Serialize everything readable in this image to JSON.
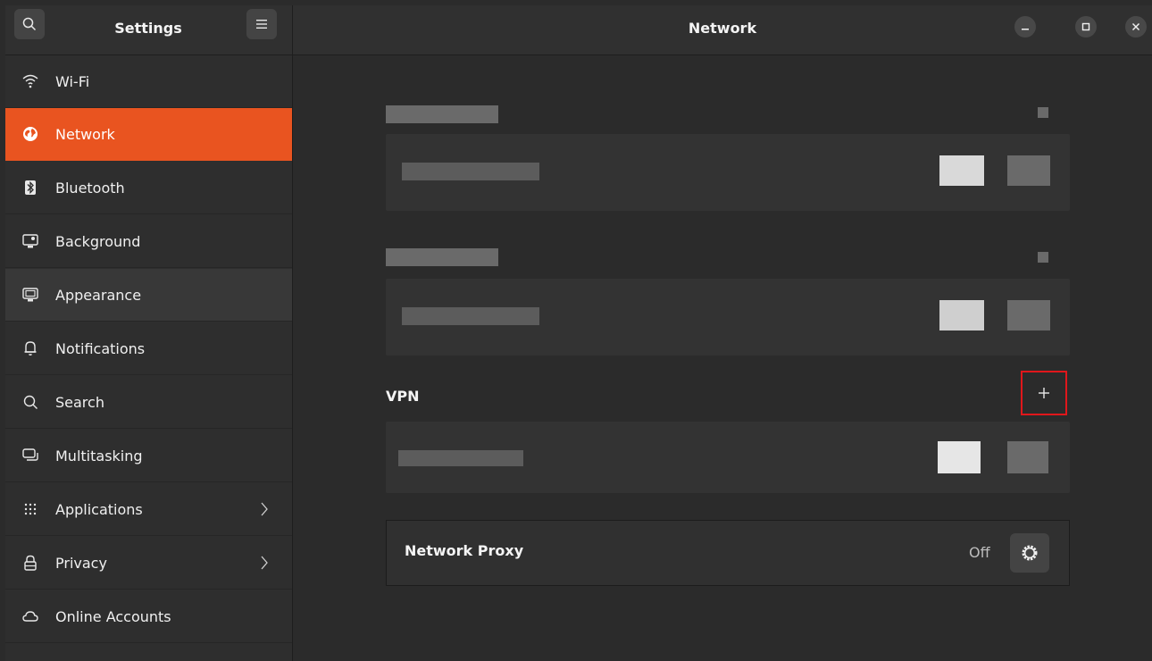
{
  "app": {
    "sidebar_title": "Settings",
    "page_title": "Network"
  },
  "sidebar": {
    "items": [
      {
        "label": "Wi-Fi",
        "icon": "wifi-icon"
      },
      {
        "label": "Network",
        "icon": "network-globe-icon",
        "active": true
      },
      {
        "label": "Bluetooth",
        "icon": "bluetooth-icon"
      },
      {
        "label": "Background",
        "icon": "background-icon"
      },
      {
        "label": "Appearance",
        "icon": "appearance-icon"
      },
      {
        "label": "Notifications",
        "icon": "bell-icon"
      },
      {
        "label": "Search",
        "icon": "search-icon"
      },
      {
        "label": "Multitasking",
        "icon": "multitasking-icon"
      },
      {
        "label": "Applications",
        "icon": "grid-icon",
        "has_submenu": true
      },
      {
        "label": "Privacy",
        "icon": "lock-icon",
        "has_submenu": true
      },
      {
        "label": "Online Accounts",
        "icon": "cloud-icon"
      }
    ]
  },
  "main": {
    "vpn": {
      "title": "VPN"
    },
    "proxy": {
      "label": "Network Proxy",
      "state": "Off"
    }
  },
  "colors": {
    "accent": "#e95420",
    "highlight_box": "#e0171b"
  }
}
